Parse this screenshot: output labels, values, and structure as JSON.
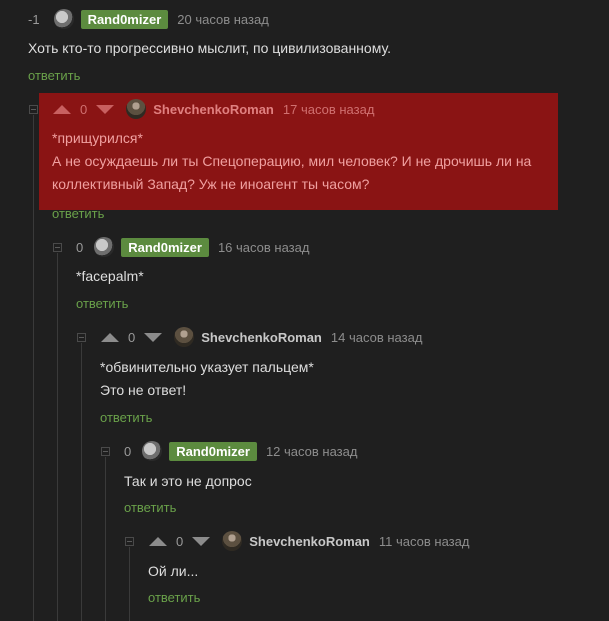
{
  "comments": [
    {
      "rating": "-1",
      "author": "Rand0mizer",
      "time": "20 часов назад",
      "lines": [
        "Хоть кто-то прогрессивно мыслит, по цивилизованному."
      ],
      "reply": "ответить"
    },
    {
      "rating": "0",
      "author": "ShevchenkoRoman",
      "time": "17 часов назад",
      "lines": [
        "*прищурился*",
        "А не осуждаешь ли ты Спецоперацию, мил человек? И не дрочишь ли на",
        "коллективный Запад? Уж не иноагент ты часом?"
      ],
      "reply": "ответить"
    },
    {
      "rating": "0",
      "author": "Rand0mizer",
      "time": "16 часов назад",
      "lines": [
        "*facepalm*"
      ],
      "reply": "ответить"
    },
    {
      "rating": "0",
      "author": "ShevchenkoRoman",
      "time": "14 часов назад",
      "lines": [
        "*обвинительно указует пальцем*",
        "Это не ответ!"
      ],
      "reply": "ответить"
    },
    {
      "rating": "0",
      "author": "Rand0mizer",
      "time": "12 часов назад",
      "lines": [
        "Так и это не допрос"
      ],
      "reply": "ответить"
    },
    {
      "rating": "0",
      "author": "ShevchenkoRoman",
      "time": "11 часов назад",
      "lines": [
        "Ой ли..."
      ],
      "reply": "ответить"
    }
  ],
  "colors": {
    "background": "#1f1f1f",
    "highlight": "#8a1414",
    "badge": "#5c8b3f",
    "reply_link": "#6aa14a"
  }
}
